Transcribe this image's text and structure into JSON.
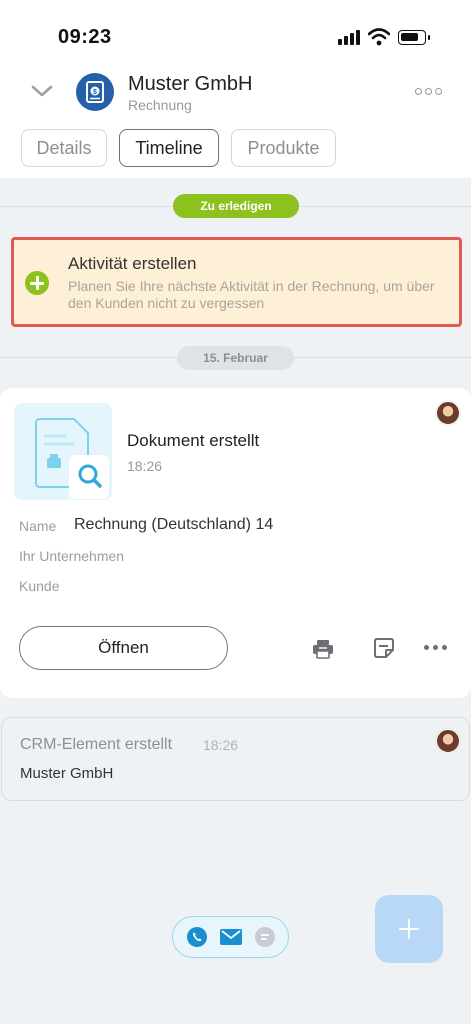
{
  "status_bar": {
    "time": "09:23",
    "signal_icon": "signal-bars-icon",
    "wifi_icon": "wifi-icon",
    "battery_icon": "battery-icon"
  },
  "header": {
    "title": "Muster GmbH",
    "subtitle": "Rechnung",
    "back_icon": "chevron-down-icon",
    "logo_icon": "invoice-dollar-icon",
    "more_icon": "more-icon"
  },
  "tabs": [
    {
      "label": "Details",
      "active": false
    },
    {
      "label": "Timeline",
      "active": true
    },
    {
      "label": "Produkte",
      "active": false
    }
  ],
  "timeline": {
    "todo_label": "Zu erledigen",
    "date_label": "15. Februar",
    "todo_color": "#8cc11e"
  },
  "activity": {
    "title": "Aktivität erstellen",
    "description": "Planen Sie Ihre nächste Aktivität in der Rechnung, um über den Kunden nicht zu vergessen",
    "highlight_color": "#e05a52",
    "background_color": "#fdf0d6"
  },
  "document_card": {
    "title": "Dokument erstellt",
    "time": "18:26",
    "fields": [
      {
        "label": "Name",
        "value": "Rechnung (Deutschland) 14"
      },
      {
        "label": "Ihr Unternehmen",
        "value": ""
      },
      {
        "label": "Kunde",
        "value": ""
      }
    ],
    "open_label": "Öffnen",
    "actions": [
      "print-icon",
      "note-icon",
      "more-icon"
    ]
  },
  "crm_card": {
    "title": "CRM-Element erstellt",
    "time": "18:26",
    "subtitle": "Muster GmbH"
  },
  "bottom": {
    "comm_icons": [
      "phone-icon",
      "mail-icon",
      "chat-icon"
    ],
    "fab_icon": "plus-icon",
    "accent_color": "#2fa8d8"
  }
}
